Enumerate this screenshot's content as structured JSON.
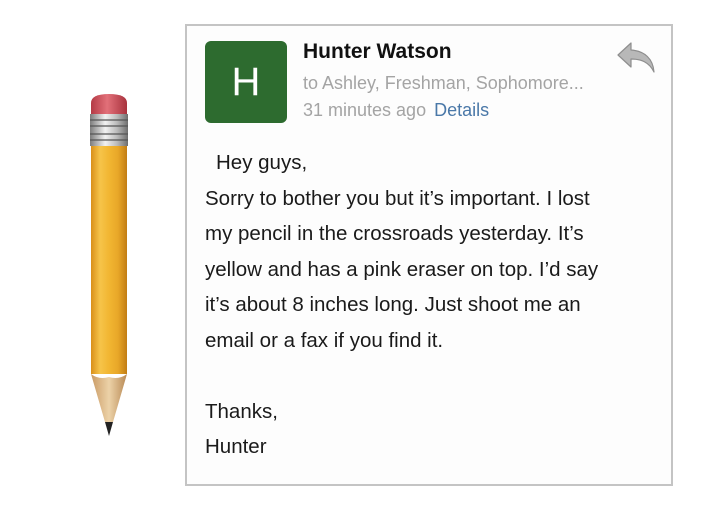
{
  "email": {
    "avatar_letter": "H",
    "avatar_color": "#2d6b2f",
    "sender": "Hunter Watson",
    "recipients": "to Ashley, Freshman, Sophomore...",
    "timestamp": "31 minutes ago",
    "details_label": "Details",
    "reply_icon": "reply-arrow",
    "greeting": "Hey guys,",
    "body_lines": [
      "Sorry to bother you but it’s important. I lost",
      "my pencil in the crossroads yesterday. It’s",
      "yellow and has a pink eraser on top. I’d say",
      "it’s about 8 inches long. Just shoot me an",
      "email or a fax if you find it."
    ],
    "closing": "Thanks,",
    "signature": "Hunter"
  },
  "illustration": {
    "object": "pencil",
    "body_color": "#f2b632",
    "eraser_color": "#d9575f"
  }
}
